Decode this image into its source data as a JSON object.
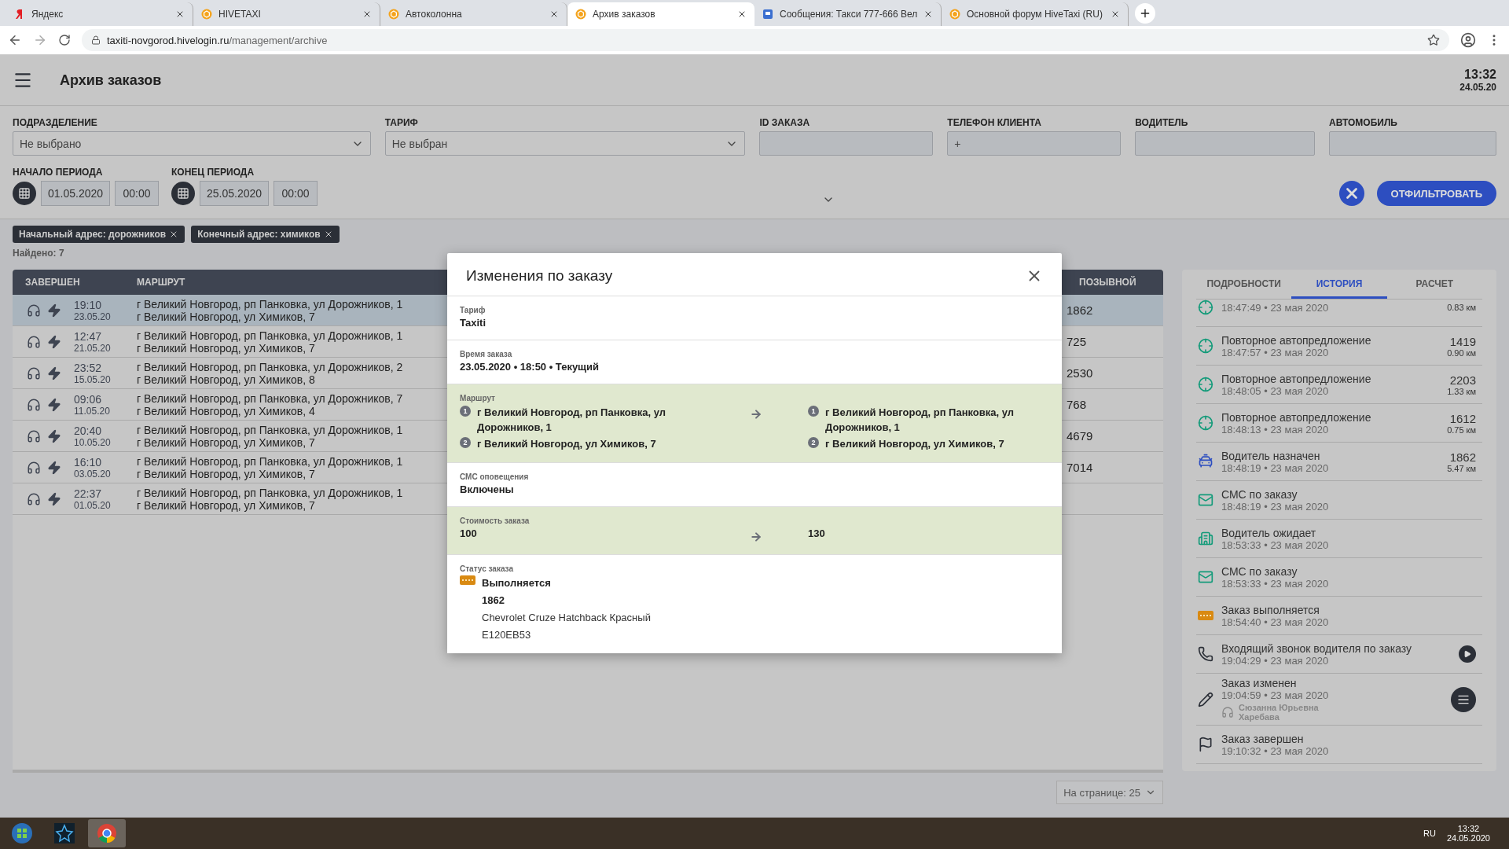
{
  "browser": {
    "tabs": [
      {
        "label": "Яндекс",
        "kind": "yandex",
        "selected": false
      },
      {
        "label": "HIVETAXI",
        "kind": "hive",
        "selected": false
      },
      {
        "label": "Автоколонна",
        "kind": "hive",
        "selected": false
      },
      {
        "label": "Архив заказов",
        "kind": "hive",
        "selected": true
      },
      {
        "label": "Сообщения: Такси 777-666 Вел",
        "kind": "chat",
        "selected": false
      },
      {
        "label": "Основной форум HiveTaxi (RU)",
        "kind": "hive",
        "selected": false
      }
    ],
    "url_host": "taxiti-novgorod.hivelogin.ru",
    "url_path": "/management/archive"
  },
  "header": {
    "title": "Архив заказов",
    "time": "13:32",
    "date": "24.05.20"
  },
  "filters": {
    "fields": [
      {
        "label": "ПОДРАЗДЕЛЕНИЕ",
        "kind": "select",
        "value": "Не выбрано"
      },
      {
        "label": "ТАРИФ",
        "kind": "select",
        "value": "Не выбран"
      },
      {
        "label": "ID ЗАКАЗА",
        "kind": "input"
      },
      {
        "label": "ТЕЛЕФОН КЛИЕНТА",
        "kind": "input",
        "value": "+"
      },
      {
        "label": "ВОДИТЕЛЬ",
        "kind": "input"
      },
      {
        "label": "АВТОМОБИЛЬ",
        "kind": "input"
      }
    ],
    "periods": [
      {
        "label": "НАЧАЛО ПЕРИОДА",
        "date": "01.05.2020",
        "time": "00:00"
      },
      {
        "label": "КОНЕЦ ПЕРИОДА",
        "date": "25.05.2020",
        "time": "00:00"
      }
    ],
    "apply_button": "ОТФИЛЬТРОВАТЬ"
  },
  "tags": [
    "Начальный адрес: дорожников",
    "Конечный адрес: химиков"
  ],
  "found": "Найдено: 7",
  "table": {
    "columns": [
      "ЗАВЕРШЕН",
      "МАРШРУТ",
      "ПОЗЫВНОЙ"
    ],
    "rows": [
      {
        "time": "19:10",
        "date": "23.05.20",
        "from": "г Великий Новгород, рп Панковка, ул Дорожников, 1",
        "to": "г Великий Новгород, ул Химиков, 7",
        "callsign": "1862",
        "selected": true
      },
      {
        "time": "12:47",
        "date": "21.05.20",
        "from": "г Великий Новгород, рп Панковка, ул Дорожников, 1",
        "to": "г Великий Новгород, ул Химиков, 7",
        "callsign": "725",
        "selected": false
      },
      {
        "time": "23:52",
        "date": "15.05.20",
        "from": "г Великий Новгород, рп Панковка, ул Дорожников, 2",
        "to": "г Великий Новгород, ул Химиков, 8",
        "callsign": "2530",
        "selected": false
      },
      {
        "time": "09:06",
        "date": "11.05.20",
        "from": "г Великий Новгород, рп Панковка, ул Дорожников, 7",
        "to": "г Великий Новгород, ул Химиков, 4",
        "callsign": "768",
        "selected": false
      },
      {
        "time": "20:40",
        "date": "10.05.20",
        "from": "г Великий Новгород, рп Панковка, ул Дорожников, 1",
        "to": "г Великий Новгород, ул Химиков, 7",
        "callsign": "4679",
        "selected": false
      },
      {
        "time": "16:10",
        "date": "03.05.20",
        "from": "г Великий Новгород, рп Панковка, ул Дорожников, 1",
        "to": "г Великий Новгород, ул Химиков, 7",
        "callsign": "7014",
        "selected": false
      },
      {
        "time": "22:37",
        "date": "01.05.20",
        "from": "г Великий Новгород, рп Панковка, ул Дорожников, 1",
        "to": "г Великий Новгород, ул Химиков, 7",
        "selected": false
      }
    ]
  },
  "pagination": "На странице: 25",
  "details": {
    "tabs": [
      {
        "label": "ПОДРОБНОСТИ",
        "selected": false
      },
      {
        "label": "ИСТОРИЯ",
        "selected": true
      },
      {
        "label": "РАСЧЕТ",
        "selected": false
      }
    ],
    "history": [
      {
        "kind": "offer",
        "time": "18:47:49 • 23 мая 2020",
        "distance": "0.83 км"
      },
      {
        "kind": "offer",
        "title": "Повторное автопредложение",
        "time": "18:47:57 • 23 мая 2020",
        "callsign": "1419",
        "distance": "0.90 км"
      },
      {
        "kind": "offer",
        "title": "Повторное автопредложение",
        "time": "18:48:05 • 23 мая 2020",
        "callsign": "2203",
        "distance": "1.33 км"
      },
      {
        "kind": "offer",
        "title": "Повторное автопредложение",
        "time": "18:48:13 • 23 мая 2020",
        "callsign": "1612",
        "distance": "0.75 км"
      },
      {
        "kind": "assigned",
        "title": "Водитель назначен",
        "time": "18:48:19 • 23 мая 2020",
        "callsign": "1862",
        "distance": "5.47 км"
      },
      {
        "kind": "sms",
        "title": "СМС по заказу",
        "time": "18:48:19 • 23 мая 2020"
      },
      {
        "kind": "waiting",
        "title": "Водитель ожидает",
        "time": "18:53:33 • 23 мая 2020"
      },
      {
        "kind": "sms",
        "title": "СМС по заказу",
        "time": "18:53:33 • 23 мая 2020"
      },
      {
        "kind": "running",
        "title": "Заказ выполняется",
        "time": "18:54:40 • 23 мая 2020"
      },
      {
        "kind": "call",
        "title": "Входящий звонок водителя по заказу",
        "time": "19:04:29 • 23 мая 2020"
      },
      {
        "kind": "edit",
        "title": "Заказ изменен",
        "time": "19:04:59 • 23 мая 2020",
        "operator": "Сюзанна Юрьевна Харебава"
      },
      {
        "kind": "done",
        "title": "Заказ завершен",
        "time": "19:10:32 • 23 мая 2020"
      }
    ]
  },
  "modal": {
    "title": "Изменения по заказу",
    "sections": [
      {
        "kind": "plain",
        "label": "Тариф",
        "value": "Taxiti",
        "changed": false
      },
      {
        "kind": "plain",
        "label": "Время заказа",
        "value": "23.05.2020 • 18:50 • Текущий",
        "changed": false
      },
      {
        "kind": "route",
        "label": "Маршрут",
        "changed": true,
        "before": [
          {
            "n": "1",
            "address": "г Великий Новгород, рп Панковка, ул Дорожников, 1"
          },
          {
            "n": "2",
            "address": "г Великий Новгород, ул Химиков, 7"
          }
        ],
        "after": [
          {
            "n": "1",
            "address": "г Великий Новгород, рп Панковка, ул Дорожников, 1"
          },
          {
            "n": "2",
            "address": "г Великий Новгород, ул Химиков, 7"
          }
        ]
      },
      {
        "kind": "plain",
        "label": "СМС оповещения",
        "value": "Включены",
        "changed": false
      },
      {
        "kind": "diff",
        "label": "Стоимость заказа",
        "changed": true,
        "before": "100",
        "after": "130"
      },
      {
        "kind": "status",
        "label": "Статус заказа",
        "changed": false,
        "status": "Выполняется",
        "callsign": "1862",
        "car": "Chevrolet Cruze Hatchback Красный",
        "plate": "Е120ЕВ53"
      }
    ]
  },
  "taskbar": {
    "lang": "RU",
    "time": "13:32",
    "date": "24.05.2020"
  }
}
